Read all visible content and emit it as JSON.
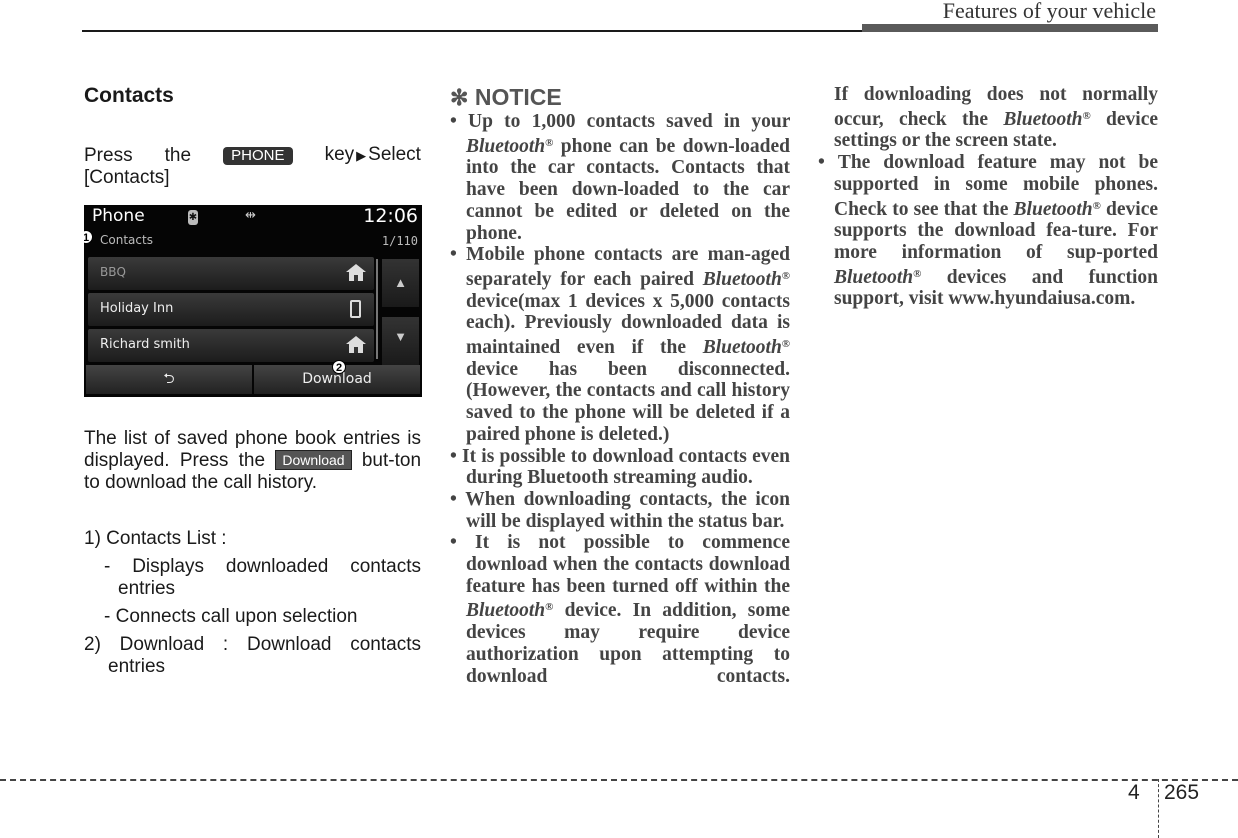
{
  "header": {
    "title": "Features of your vehicle"
  },
  "section": {
    "title": "Contacts",
    "instruction": {
      "press": "Press",
      "the": "the",
      "key_badge": "PHONE",
      "key_word": "key",
      "arrow": "▶",
      "select": "Select",
      "target": "[Contacts]"
    }
  },
  "screen": {
    "app_title": "Phone",
    "bluetooth_icon": "bluetooth-icon",
    "usb_icon": "usb-icon",
    "time": "12:06",
    "sub_title": "Contacts",
    "count": "1/110",
    "contacts": [
      {
        "name": "BBQ",
        "icon": "home-icon"
      },
      {
        "name": "Holiday Inn",
        "icon": "mobile-phone-icon"
      },
      {
        "name": "Richard smith",
        "icon": "home-icon"
      }
    ],
    "scroll_up": "▲",
    "scroll_down": "▼",
    "back_button": "⮌",
    "download_button": "Download",
    "callout_1": "1",
    "callout_2": "2"
  },
  "description": {
    "part1": "The list of saved phone book entries is displayed. Press the",
    "badge": "Download",
    "part2": "but-ton to download the call history."
  },
  "list": {
    "item1": "1) Contacts List :",
    "item1_sub1": "- Displays downloaded contacts entries",
    "item1_sub2": "- Connects call upon selection",
    "item2": "2) Download : Download contacts entries"
  },
  "notice": {
    "asterisk": "✻",
    "title": "NOTICE",
    "bluetooth": "Bluetooth",
    "reg": "®",
    "b1_a": "Up to 1,000 contacts saved in your",
    "b1_b": "phone can be down-loaded into the car contacts. Contacts that have been down-loaded to the car cannot be edited or deleted on the phone.",
    "b2_a": "Mobile phone contacts are man-aged separately for each paired",
    "b2_b": "device(max 1 devices x 5,000 contacts each). Previously downloaded data is maintained even if the",
    "b2_c": "device has been disconnected. (However, the contacts and call history saved to the phone will be deleted if a paired phone is deleted.)",
    "b3": "It is possible to download contacts even during Bluetooth streaming audio.",
    "b4": "When downloading contacts, the icon will be displayed within the status bar.",
    "b5_a": "It is not possible to commence download when the contacts download feature has been turned off within the",
    "b5_b": "device. In addition, some devices may require device authorization upon attempting to download contacts.",
    "c2_a": "If downloading does not normally occur, check the",
    "c2_b": "device settings or the screen state.",
    "b6_a": "The download feature may not be supported in some mobile phones. Check to see that the",
    "b6_b": "device supports the download fea-ture. For more information of sup-ported",
    "b6_c": "devices and function support, visit www.hyundaiusa.com."
  },
  "footer": {
    "chapter": "4",
    "page": "265"
  }
}
